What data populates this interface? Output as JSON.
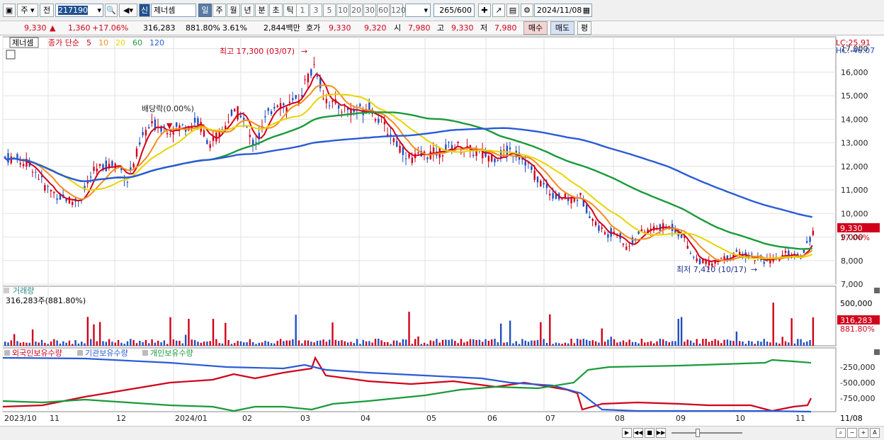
{
  "toolbar": {
    "type_label": "주",
    "prev_label": "전",
    "code": "217190",
    "new_badge": "신",
    "stock_name": "제너셈",
    "period_tabs": [
      "일",
      "주",
      "월",
      "년",
      "분",
      "초",
      "틱"
    ],
    "tick_tabs": [
      "1",
      "3",
      "5",
      "10",
      "20",
      "30",
      "60",
      "120"
    ],
    "count_value": "265",
    "count_total": "/600",
    "date": "2024/11/08"
  },
  "quote": {
    "price": "9,330",
    "change": "1,360",
    "change_pct": "+17.06%",
    "volume": "316,283",
    "vol_ratio": "881.80%",
    "turnover": "3.61%",
    "amount": "2,844백만",
    "hoga_label": "호가",
    "ask": "9,330",
    "bid": "9,320",
    "open_label": "시",
    "open": "7,980",
    "high_label": "고",
    "high": "9,330",
    "low_label": "저",
    "low": "7,980",
    "buy_label": "매수",
    "sell_label": "매도",
    "eval_label": "평"
  },
  "price_panel": {
    "name_tag": "제너셈",
    "legend_title": "종가 단순",
    "ma": [
      {
        "label": "5",
        "color": "#d0021b"
      },
      {
        "label": "10",
        "color": "#f58c1e"
      },
      {
        "label": "20",
        "color": "#e8d400"
      },
      {
        "label": "60",
        "color": "#1a9a3a"
      },
      {
        "label": "120",
        "color": "#2a5bd7"
      }
    ],
    "lc": "LC:25.91",
    "hc": "HC:-46.07",
    "high_note": "최고 17,300 (03/07)",
    "low_note": "최저 7,410 (10/17)",
    "dividend_note": "배당락(0.00%)",
    "price_tag": "9,330",
    "pct_tag": "17.06%",
    "y_ticks": [
      "17,000",
      "16,000",
      "15,000",
      "14,000",
      "13,000",
      "12,000",
      "11,000",
      "10,000",
      "9,000",
      "8,000",
      "7,000"
    ]
  },
  "volume_panel": {
    "title": "거래량",
    "value": "316,283주(881.80%)",
    "tick": "500,000",
    "tag_value": "316,283",
    "tag_pct": "881.80%"
  },
  "holding_panel": {
    "labels": [
      "외국인보유수량",
      "기관보유수량",
      "개인보유수량"
    ],
    "colors": [
      "#d0021b",
      "#2a5bd7",
      "#1a9a3a"
    ],
    "y_ticks": [
      "-250,000",
      "-500,000",
      "-750,000"
    ]
  },
  "x_axis": {
    "labels": [
      "2023/10",
      "11",
      "12",
      "2024/01",
      "02",
      "03",
      "04",
      "05",
      "06",
      "07",
      "08",
      "09",
      "10",
      "11"
    ],
    "right_label": "11/08"
  },
  "chart_data": {
    "type": "candlestick",
    "price_range": [
      7000,
      17500
    ],
    "months": [
      "2023/10",
      "11",
      "12",
      "2024/01",
      "02",
      "03",
      "04",
      "05",
      "06",
      "07",
      "08",
      "09",
      "10",
      "11"
    ],
    "close_path": [
      [
        0,
        12400
      ],
      [
        20,
        12300
      ],
      [
        40,
        12000
      ],
      [
        60,
        11100
      ],
      [
        80,
        10700
      ],
      [
        100,
        10500
      ],
      [
        110,
        10700
      ],
      [
        125,
        11700
      ],
      [
        140,
        12000
      ],
      [
        160,
        12100
      ],
      [
        175,
        11400
      ],
      [
        185,
        12300
      ],
      [
        200,
        13500
      ],
      [
        215,
        13800
      ],
      [
        235,
        13600
      ],
      [
        255,
        13700
      ],
      [
        275,
        13900
      ],
      [
        290,
        13000
      ],
      [
        305,
        13300
      ],
      [
        320,
        14200
      ],
      [
        335,
        14300
      ],
      [
        350,
        13000
      ],
      [
        360,
        13200
      ],
      [
        370,
        14000
      ],
      [
        385,
        14800
      ],
      [
        400,
        14500
      ],
      [
        415,
        14800
      ],
      [
        430,
        15800
      ],
      [
        440,
        16400
      ],
      [
        450,
        15100
      ],
      [
        465,
        14600
      ],
      [
        480,
        14500
      ],
      [
        500,
        14300
      ],
      [
        515,
        14600
      ],
      [
        530,
        14000
      ],
      [
        545,
        13400
      ],
      [
        560,
        12800
      ],
      [
        575,
        12300
      ],
      [
        595,
        12500
      ],
      [
        615,
        12600
      ],
      [
        635,
        12900
      ],
      [
        655,
        12700
      ],
      [
        675,
        12500
      ],
      [
        695,
        12400
      ],
      [
        715,
        12700
      ],
      [
        735,
        12300
      ],
      [
        750,
        11600
      ],
      [
        765,
        11100
      ],
      [
        780,
        10700
      ],
      [
        800,
        10600
      ],
      [
        815,
        10700
      ],
      [
        825,
        10100
      ],
      [
        835,
        9600
      ],
      [
        850,
        9100
      ],
      [
        865,
        9300
      ],
      [
        880,
        8500
      ],
      [
        895,
        9100
      ],
      [
        910,
        9300
      ],
      [
        925,
        9400
      ],
      [
        945,
        9400
      ],
      [
        960,
        9000
      ],
      [
        975,
        8100
      ],
      [
        990,
        7900
      ],
      [
        1005,
        7900
      ],
      [
        1020,
        8100
      ],
      [
        1035,
        8300
      ],
      [
        1055,
        8200
      ],
      [
        1075,
        8000
      ],
      [
        1090,
        8000
      ],
      [
        1105,
        8300
      ],
      [
        1125,
        8200
      ],
      [
        1145,
        9330
      ]
    ],
    "volume_max": 600000
  }
}
